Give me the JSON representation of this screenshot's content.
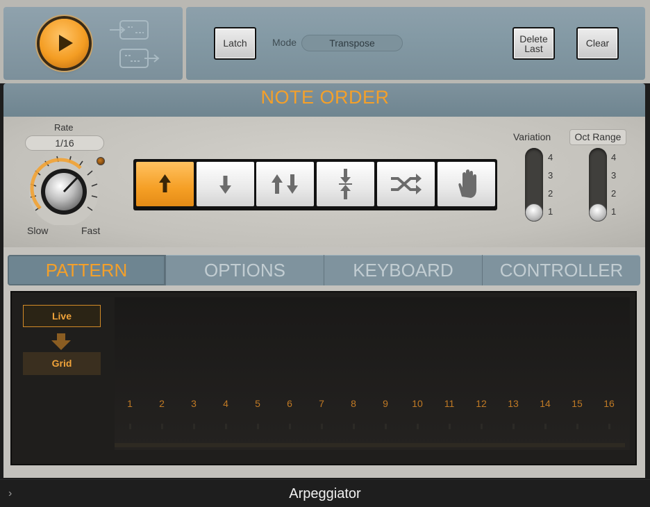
{
  "transport": {
    "play_icon": "play-icon",
    "input_icon": "midi-input-icon",
    "output_icon": "midi-output-icon"
  },
  "controls": {
    "latch_label": "Latch",
    "mode_label": "Mode",
    "mode_value": "Transpose",
    "delete_last_line1": "Delete",
    "delete_last_line2": "Last",
    "clear_label": "Clear"
  },
  "note_order": {
    "title": "NOTE ORDER",
    "rate_label": "Rate",
    "rate_value": "1/16",
    "slow_label": "Slow",
    "fast_label": "Fast",
    "buttons": [
      {
        "name": "up",
        "icon": "arrow-up-icon",
        "active": true
      },
      {
        "name": "down",
        "icon": "arrow-down-icon",
        "active": false
      },
      {
        "name": "up-down",
        "icon": "arrows-up-down-icon",
        "active": false
      },
      {
        "name": "outside-in",
        "icon": "arrows-converge-icon",
        "active": false
      },
      {
        "name": "random",
        "icon": "shuffle-icon",
        "active": false
      },
      {
        "name": "as-played",
        "icon": "hand-icon",
        "active": false
      }
    ],
    "variation_label": "Variation",
    "variation_scale": [
      "4",
      "3",
      "2",
      "1"
    ],
    "variation_value": 1,
    "oct_range_label": "Oct Range",
    "oct_range_scale": [
      "4",
      "3",
      "2",
      "1"
    ],
    "oct_range_value": 1
  },
  "tabs": [
    {
      "label": "PATTERN",
      "active": true
    },
    {
      "label": "OPTIONS",
      "active": false
    },
    {
      "label": "KEYBOARD",
      "active": false
    },
    {
      "label": "CONTROLLER",
      "active": false
    }
  ],
  "pattern": {
    "live_label": "Live",
    "grid_label": "Grid",
    "steps": [
      "1",
      "2",
      "3",
      "4",
      "5",
      "6",
      "7",
      "8",
      "9",
      "10",
      "11",
      "12",
      "13",
      "14",
      "15",
      "16"
    ]
  },
  "footer": {
    "title": "Arpeggiator",
    "chevron": "›"
  },
  "colors": {
    "accent": "#f4a02a",
    "panel_blue": "#7f939e",
    "body_gray": "#c4c2bd"
  }
}
